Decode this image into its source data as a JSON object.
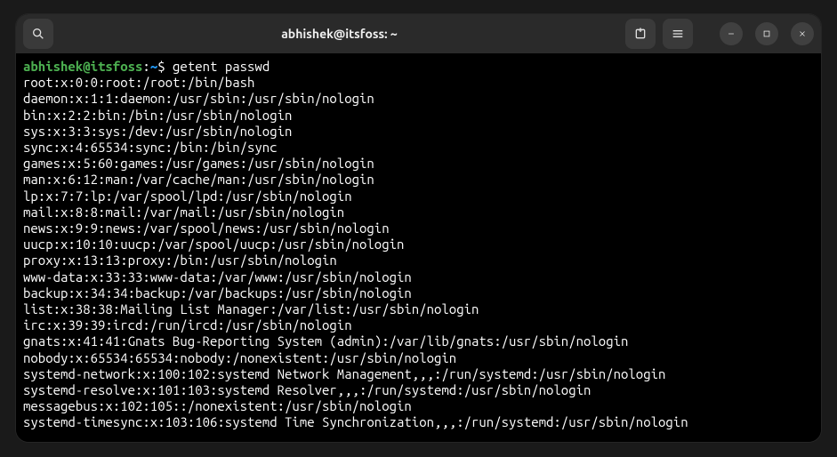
{
  "titlebar": {
    "title": "abhishek@itsfoss: ~"
  },
  "prompt": {
    "userhost": "abhishek@itsfoss",
    "colon": ":",
    "path": "~",
    "dollar": "$"
  },
  "command": "getent passwd",
  "output": [
    "root:x:0:0:root:/root:/bin/bash",
    "daemon:x:1:1:daemon:/usr/sbin:/usr/sbin/nologin",
    "bin:x:2:2:bin:/bin:/usr/sbin/nologin",
    "sys:x:3:3:sys:/dev:/usr/sbin/nologin",
    "sync:x:4:65534:sync:/bin:/bin/sync",
    "games:x:5:60:games:/usr/games:/usr/sbin/nologin",
    "man:x:6:12:man:/var/cache/man:/usr/sbin/nologin",
    "lp:x:7:7:lp:/var/spool/lpd:/usr/sbin/nologin",
    "mail:x:8:8:mail:/var/mail:/usr/sbin/nologin",
    "news:x:9:9:news:/var/spool/news:/usr/sbin/nologin",
    "uucp:x:10:10:uucp:/var/spool/uucp:/usr/sbin/nologin",
    "proxy:x:13:13:proxy:/bin:/usr/sbin/nologin",
    "www-data:x:33:33:www-data:/var/www:/usr/sbin/nologin",
    "backup:x:34:34:backup:/var/backups:/usr/sbin/nologin",
    "list:x:38:38:Mailing List Manager:/var/list:/usr/sbin/nologin",
    "irc:x:39:39:ircd:/run/ircd:/usr/sbin/nologin",
    "gnats:x:41:41:Gnats Bug-Reporting System (admin):/var/lib/gnats:/usr/sbin/nologin",
    "nobody:x:65534:65534:nobody:/nonexistent:/usr/sbin/nologin",
    "systemd-network:x:100:102:systemd Network Management,,,:/run/systemd:/usr/sbin/nologin",
    "systemd-resolve:x:101:103:systemd Resolver,,,:/run/systemd:/usr/sbin/nologin",
    "messagebus:x:102:105::/nonexistent:/usr/sbin/nologin",
    "systemd-timesync:x:103:106:systemd Time Synchronization,,,:/run/systemd:/usr/sbin/nologin"
  ]
}
